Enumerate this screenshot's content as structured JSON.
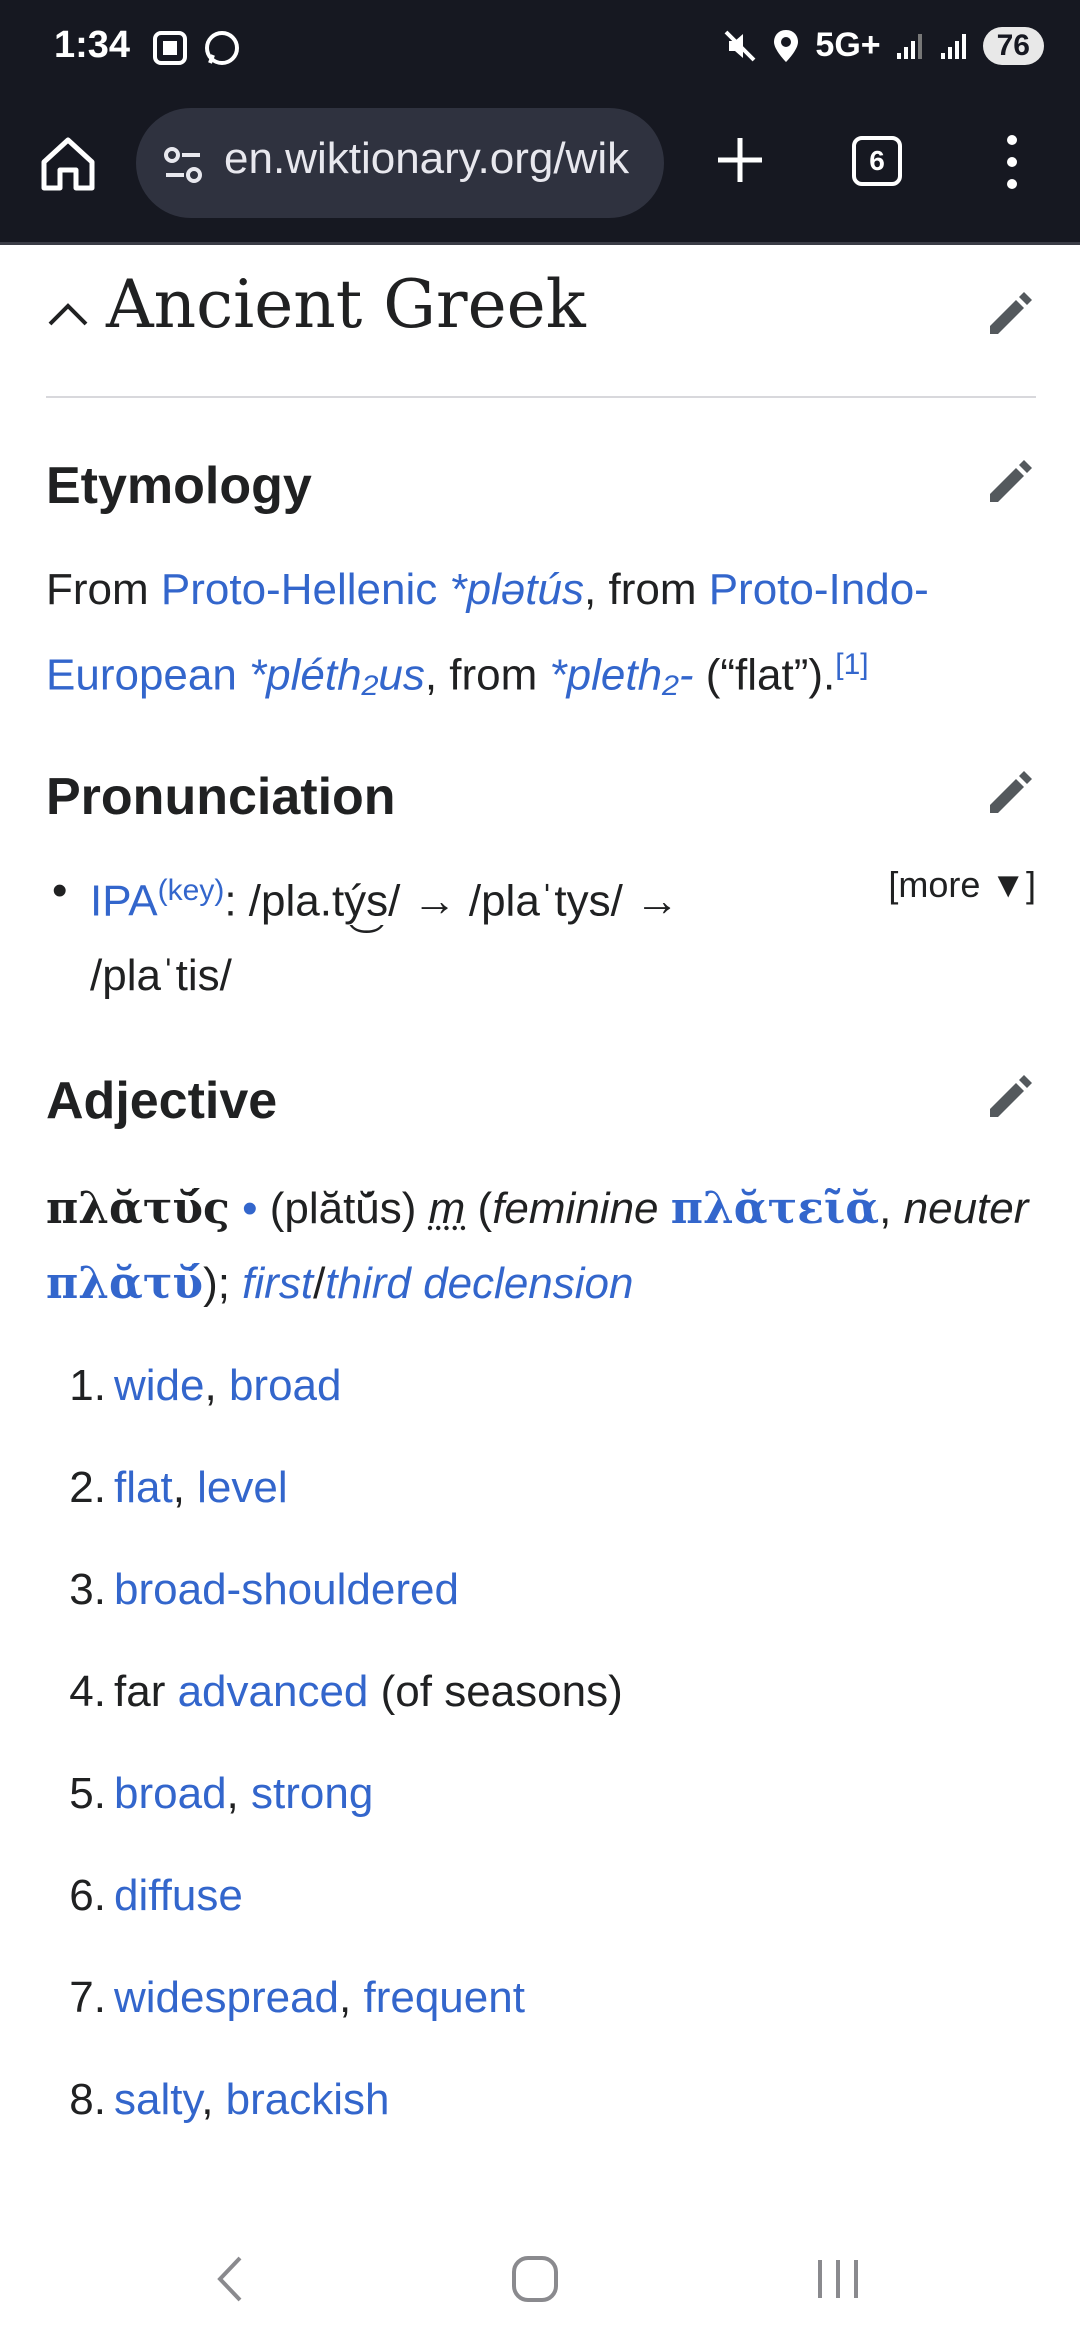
{
  "status_bar": {
    "time": "1:34",
    "network": "5G+",
    "battery": "76"
  },
  "browser": {
    "url": "en.wiktionary.org/wik",
    "tab_count": "6"
  },
  "language": {
    "title": "Ancient Greek"
  },
  "etymology": {
    "heading": "Etymology",
    "from1": "From ",
    "link_ph": "Proto-Hellenic",
    "sp1": " ",
    "term_ph": "*plətús",
    "comma1": ", from ",
    "link_pie": "Proto-Indo-European",
    "sp2": " ",
    "term_pie": "*pléth₂us",
    "comma2": ", from ",
    "term_root": "*pleth₂-",
    "gloss": " (“flat”).",
    "ref": "[1]"
  },
  "pronunciation": {
    "heading": "Pronunciation",
    "ipa_link": "IPA",
    "key_link": "(key)",
    "ipa_text": ": /pla.tý͜s/ → /plaˈtys/ → /plaˈtis/",
    "more": "[more ▼]"
  },
  "adjective": {
    "heading": "Adjective",
    "headword": "πλᾰτῠ́ς",
    "bullet": " • ",
    "translit": "(plătŭ́s) ",
    "gender": "m",
    "open": " (",
    "feminine_label": "feminine",
    "feminine_form": "πλᾰτεῖᾰ",
    "neuter_sep": ", ",
    "neuter_label": "neuter",
    "neuter_form": "πλᾰτῠ́",
    "close": "); ",
    "decl1": "first",
    "slash": "/",
    "decl2": "third declension",
    "definitions": [
      {
        "num": "1.",
        "parts": [
          "wide",
          ", ",
          "broad"
        ]
      },
      {
        "num": "2.",
        "parts": [
          "flat",
          ", ",
          "level"
        ]
      },
      {
        "num": "3.",
        "parts": [
          "broad-shouldered"
        ]
      },
      {
        "num": "4.",
        "parts": [
          "far ",
          "advanced",
          " (of seasons)"
        ]
      },
      {
        "num": "5.",
        "parts": [
          "broad",
          ", ",
          "strong"
        ]
      },
      {
        "num": "6.",
        "parts": [
          "diffuse"
        ]
      },
      {
        "num": "7.",
        "parts": [
          "widespread",
          ", ",
          "frequent"
        ]
      },
      {
        "num": "8.",
        "parts": [
          "salty",
          ", ",
          "brackish"
        ]
      }
    ]
  }
}
